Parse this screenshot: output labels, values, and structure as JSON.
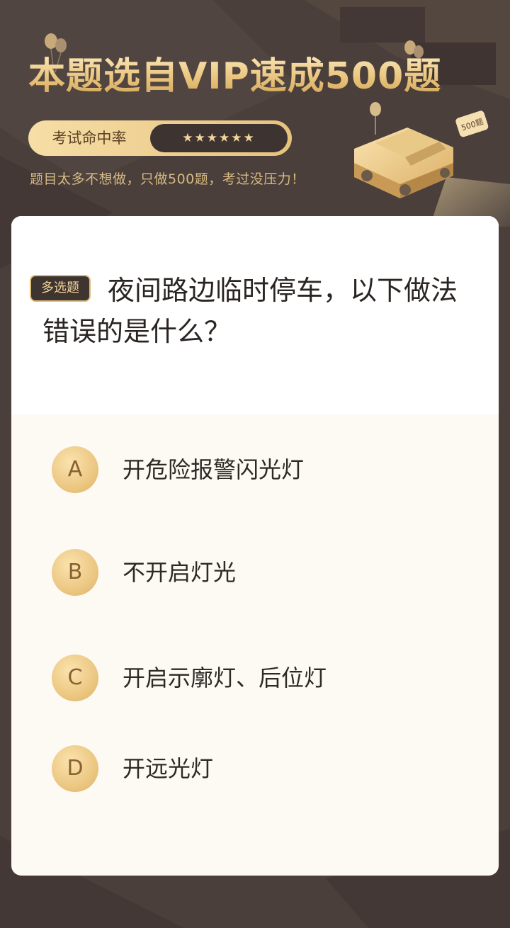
{
  "header": {
    "title": "本题选自VIP速成500题",
    "rate_label": "考试命中率",
    "rate_stars": "★★★★★★",
    "subtitle": "题目太多不想做，只做500题，考过没压力！",
    "car_badge": "500题"
  },
  "question": {
    "type_badge": "多选题",
    "text": "夜间路边临时停车，以下做法错误的是什么？"
  },
  "options": [
    {
      "letter": "A",
      "text": "开危险报警闪光灯"
    },
    {
      "letter": "B",
      "text": "不开启灯光"
    },
    {
      "letter": "C",
      "text": "开启示廓灯、后位灯"
    },
    {
      "letter": "D",
      "text": "开远光灯"
    }
  ],
  "colors": {
    "background": "#4a3f3b",
    "gold": "#e8c27a",
    "dark_badge": "#3e3430",
    "card": "#fdfaf4"
  }
}
